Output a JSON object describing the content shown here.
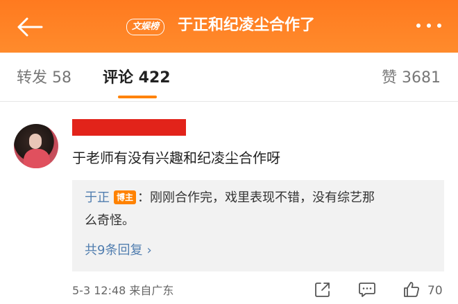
{
  "header": {
    "badge_label": "文娱榜",
    "title": "于正和纪凌尘合作了",
    "back_icon": "back-arrow-icon",
    "more_icon": "more-dots-icon"
  },
  "tabs": [
    {
      "label": "转发 58"
    },
    {
      "label": "评论 422"
    },
    {
      "label": "赞 3681"
    }
  ],
  "comment": {
    "text": "于老师有没有兴趣和纪凌尘合作呀",
    "reply": {
      "author": "于正",
      "badge": "博主",
      "text_line1": "：刚刚合作完，戏里表现不错，没有综艺那",
      "text_line2": "么奇怪。",
      "more_label": "共9条回复",
      "more_chevron": "›"
    },
    "meta": "5-3 12:48 来自广东",
    "like_count": "70"
  },
  "colors": {
    "brand_orange": "#ff8200",
    "link_blue": "#507daf",
    "redaction_red": "#e2231a"
  }
}
